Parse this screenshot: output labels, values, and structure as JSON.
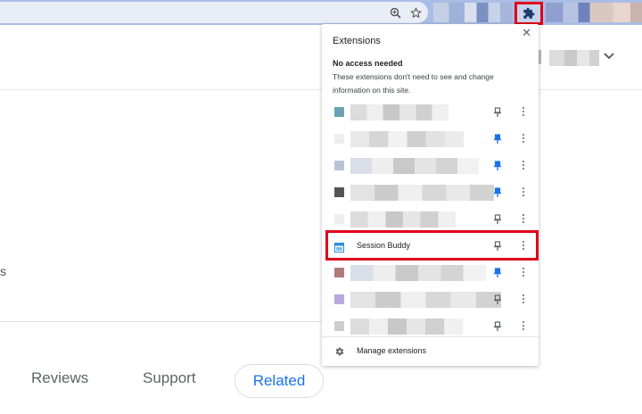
{
  "popup": {
    "title": "Extensions",
    "section_heading": "No access needed",
    "section_desc": "These extensions don't need to see and change information on this site.",
    "manage_label": "Manage extensions",
    "rows": [
      {
        "name": "",
        "pinned": false,
        "icon_color": "#6aa3b6"
      },
      {
        "name": "",
        "pinned": true,
        "icon_color": "#eeeeee"
      },
      {
        "name": "",
        "pinned": true,
        "icon_color": "#b6c4d6"
      },
      {
        "name": "",
        "pinned": true,
        "icon_color": "#555555"
      },
      {
        "name": "",
        "pinned": false,
        "icon_color": "#eeeeee"
      },
      {
        "name": "Session Buddy",
        "pinned": false,
        "icon_color": "#2b8fdb"
      },
      {
        "name": "",
        "pinned": true,
        "icon_color": "#b07b7b"
      },
      {
        "name": "",
        "pinned": false,
        "icon_color": "#b8a8dc"
      },
      {
        "name": "",
        "pinned": false,
        "icon_color": "#cccccc"
      }
    ]
  },
  "page": {
    "left_fragment": "s",
    "tabs": {
      "reviews": "Reviews",
      "support": "Support",
      "related": "Related"
    }
  },
  "colors": {
    "highlight": "#e0001a",
    "accent": "#1a73e8",
    "toolbar": "#a9bde6"
  },
  "icons": [
    "zoom-icon",
    "star-icon",
    "puzzle-icon",
    "close-icon",
    "pin-icon",
    "kebab-menu-icon",
    "gear-icon",
    "chevron-down-icon"
  ]
}
